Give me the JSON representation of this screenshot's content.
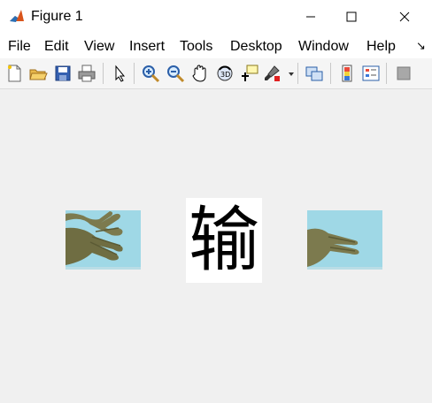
{
  "window": {
    "title": "Figure 1"
  },
  "menu": [
    "File",
    "Edit",
    "View",
    "Insert",
    "Tools",
    "Desktop",
    "Window",
    "Help"
  ],
  "toolbar": {
    "icons": [
      "new-figure-icon",
      "open-file-icon",
      "save-icon",
      "print-icon",
      "edit-plot-arrow-icon",
      "zoom-in-icon",
      "zoom-out-icon",
      "pan-hand-icon",
      "rotate-3d-icon",
      "data-cursor-icon",
      "brush-icon",
      "link-plot-icon",
      "insert-colorbar-icon",
      "insert-legend-icon",
      "hide-plot-tools-icon"
    ]
  },
  "figure": {
    "result_char": "输",
    "left_image": "open-hand-photo",
    "right_image": "scissors-hand-photo"
  },
  "colors": {
    "photo_bg": "#9fd8e6",
    "hand_skin": "#7c7a4e"
  }
}
